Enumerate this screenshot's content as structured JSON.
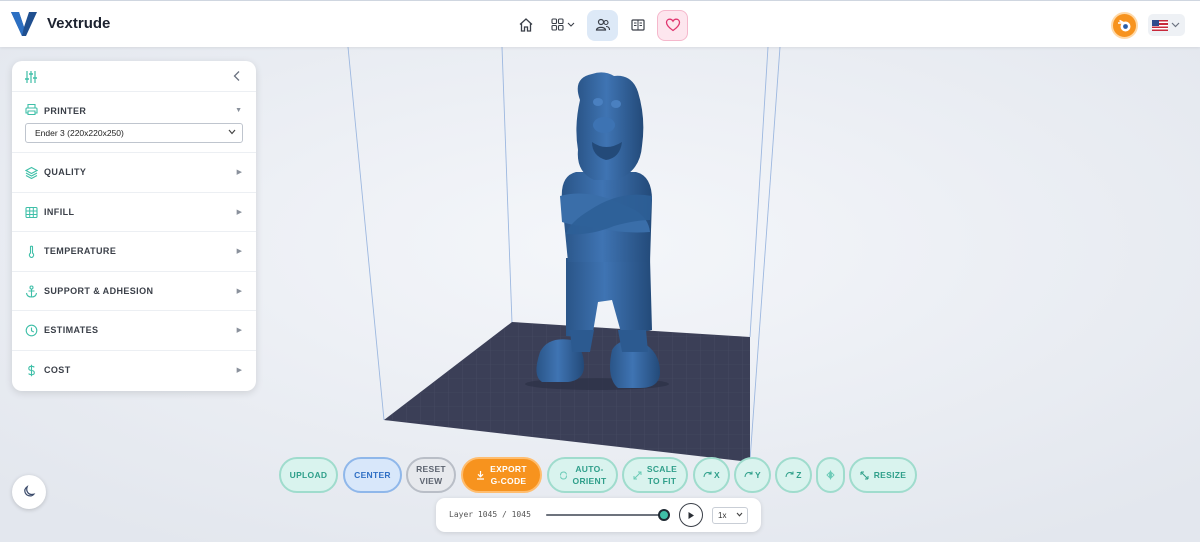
{
  "app": {
    "name": "Vextrude"
  },
  "nav": {
    "items": [
      {
        "name": "home-icon"
      },
      {
        "name": "apps-grid-icon"
      },
      {
        "name": "community-icon"
      },
      {
        "name": "docs-icon"
      },
      {
        "name": "favorites-heart-icon"
      }
    ]
  },
  "sidebar": {
    "printer": {
      "label": "PRINTER",
      "selected": "Ender 3 (220x220x250)"
    },
    "sections": [
      {
        "label": "QUALITY",
        "icon": "layers-icon"
      },
      {
        "label": "INFILL",
        "icon": "grid-icon"
      },
      {
        "label": "TEMPERATURE",
        "icon": "thermometer-icon"
      },
      {
        "label": "SUPPORT & ADHESION",
        "icon": "anchor-icon"
      },
      {
        "label": "ESTIMATES",
        "icon": "clock-icon"
      },
      {
        "label": "COST",
        "icon": "dollar-icon"
      }
    ]
  },
  "toolbar": {
    "upload": "UPLOAD",
    "center": "CENTER",
    "reset_line1": "RESET",
    "reset_line2": "VIEW",
    "export_line1": "EXPORT",
    "export_line2": "G-CODE",
    "auto_line1": "AUTO-",
    "auto_line2": "ORIENT",
    "scale_line1": "SCALE",
    "scale_line2": "TO FIT",
    "rot_x": "X",
    "rot_y": "Y",
    "rot_z": "Z",
    "resize": "RESIZE"
  },
  "layer": {
    "text": "Layer 1045 / 1045",
    "current": 1045,
    "total": 1045,
    "speed": "1x"
  },
  "colors": {
    "accent_teal": "#3fbfa8",
    "export_orange": "#f7931e",
    "model_blue": "#2f5f96",
    "bed": "#3b3f57"
  }
}
